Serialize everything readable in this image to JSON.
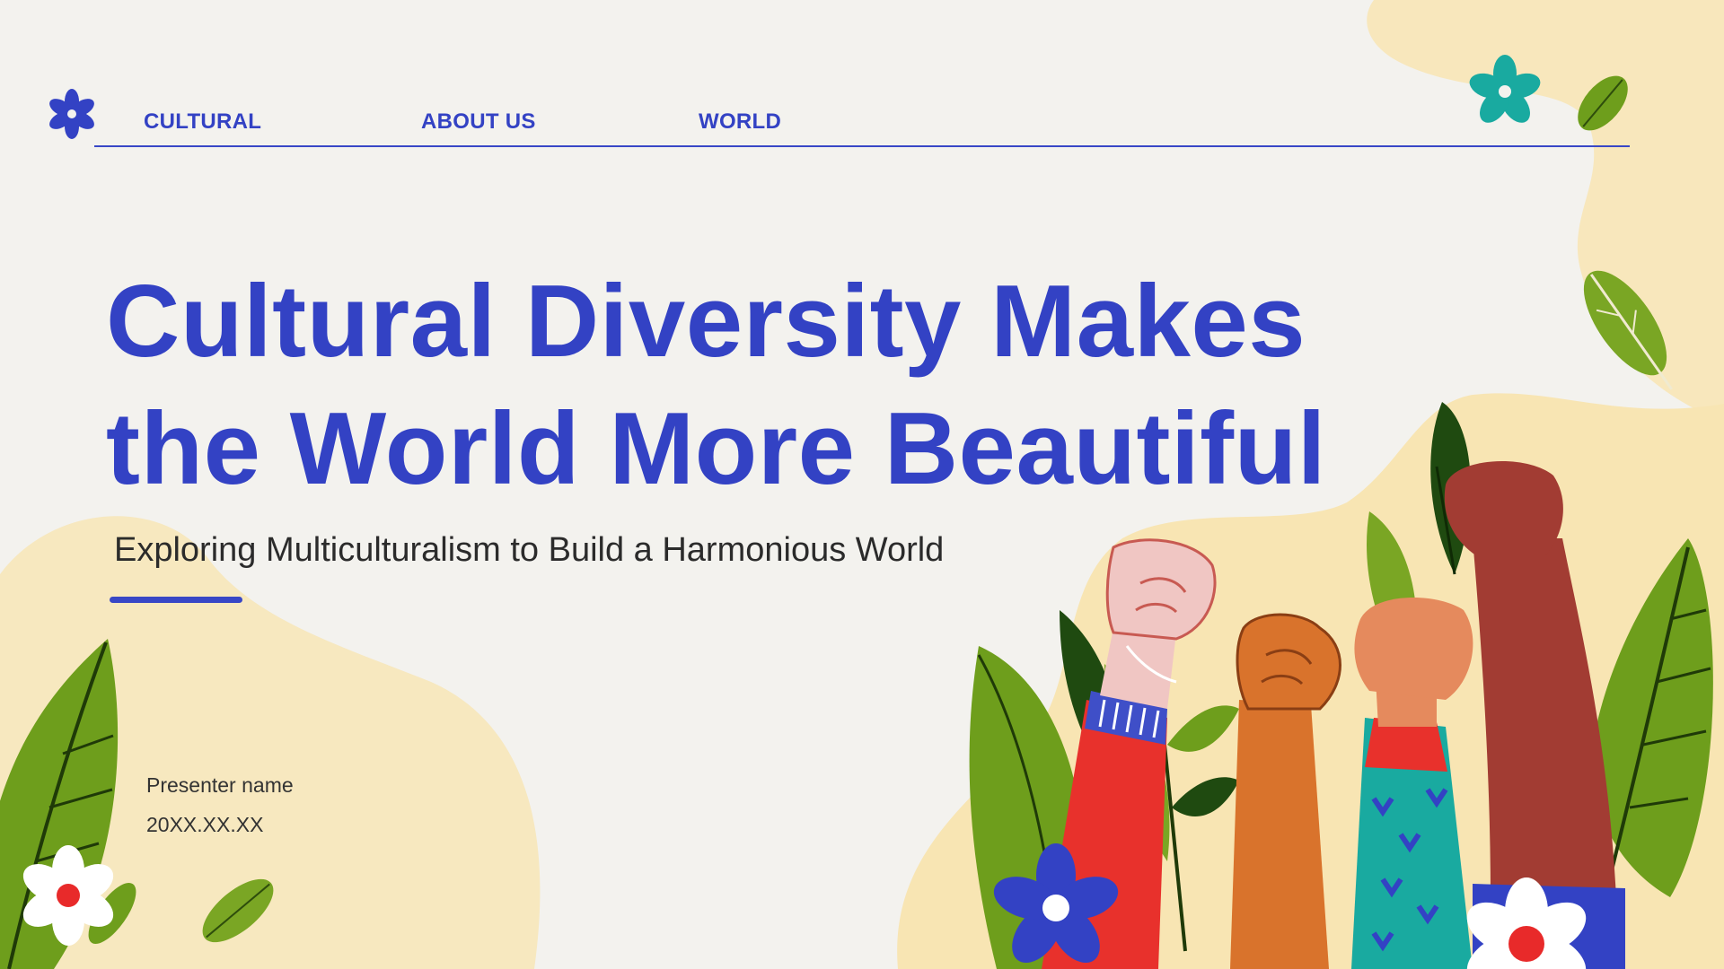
{
  "nav": {
    "items": [
      {
        "label": "CULTURAL"
      },
      {
        "label": "ABOUT US"
      },
      {
        "label": "WORLD"
      }
    ]
  },
  "slide": {
    "title_line1": "Cultural Diversity Makes",
    "title_line2": "the World More Beautiful",
    "subtitle": "Exploring Multiculturalism to Build a Harmonious World",
    "presenter": "Presenter name",
    "date": "20XX.XX.XX"
  },
  "colors": {
    "primary": "#3342c4",
    "background": "#f3f2ee",
    "blob": "#f8e5b3",
    "leaf": "#6e9e1c",
    "teal": "#19aaa0"
  },
  "icons": [
    "flower-icon",
    "leaf-icon",
    "raised-fist-illustration"
  ]
}
